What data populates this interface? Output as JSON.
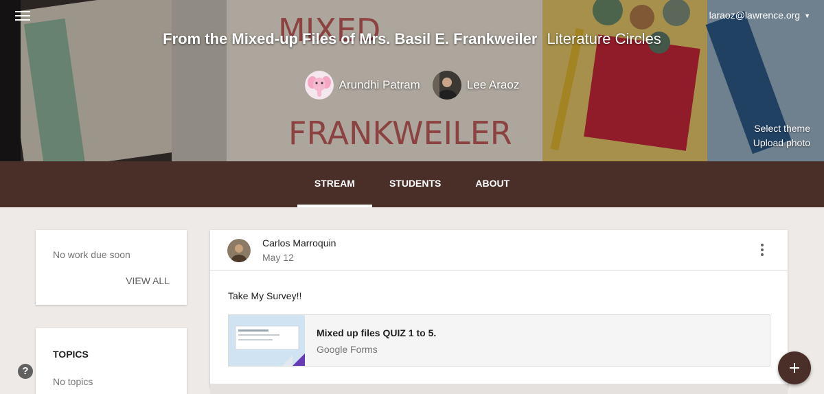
{
  "header": {
    "account": "laraoz@lawrence.org",
    "class_name": "From the Mixed-up Files of Mrs. Basil E. Frankweiler",
    "section": "Literature Circles",
    "teachers": [
      {
        "name": "Arundhi Patram",
        "avatar_icon": "pink-elephant-avatar"
      },
      {
        "name": "Lee Araoz",
        "avatar_icon": "person-photo-avatar"
      }
    ],
    "select_theme": "Select theme",
    "upload_photo": "Upload photo"
  },
  "tabs": [
    {
      "label": "STREAM",
      "active": true
    },
    {
      "label": "STUDENTS",
      "active": false
    },
    {
      "label": "ABOUT",
      "active": false
    }
  ],
  "upcoming": {
    "empty_text": "No work due soon",
    "view_all": "VIEW ALL"
  },
  "topics": {
    "heading": "TOPICS",
    "empty_text": "No topics"
  },
  "post": {
    "author": "Carlos Marroquin",
    "date": "May 12",
    "body": "Take My Survey!!",
    "attachment": {
      "title": "Mixed up files QUIZ 1 to 5.",
      "source": "Google Forms"
    }
  },
  "colors": {
    "tab_bar": "#4a2f28",
    "page_bg": "#eeeae7",
    "fab": "#4a2f28"
  }
}
